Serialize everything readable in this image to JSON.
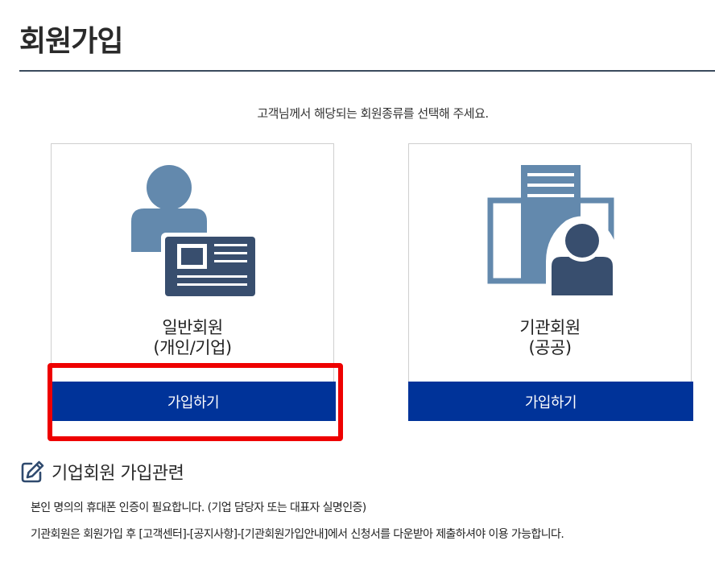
{
  "page": {
    "title": "회원가입",
    "intro": "고객님께서 해당되는 회원종류를 선택해 주세요."
  },
  "cards": [
    {
      "icon": "id-card-person-icon",
      "label_line1": "일반회원",
      "label_line2": "(개인/기업)",
      "button_label": "가입하기"
    },
    {
      "icon": "building-person-icon",
      "label_line1": "기관회원",
      "label_line2": "(공공)",
      "button_label": "가입하기"
    }
  ],
  "section": {
    "icon": "edit-icon",
    "title": "기업회원 가입관련",
    "notices": [
      "본인 명의의 휴대폰 인증이 필요합니다. (기업 담당자 또는 대표자 실명인증)",
      "기관회원은 회원가입 후 [고객센터]-[공지사항]-[기관회원가입안내]에서 신청서를 다운받아 제출하셔야 이용 가능합니다."
    ]
  },
  "colors": {
    "button_bg": "#003399",
    "highlight": "#ee0000",
    "icon_light": "#6389ad",
    "icon_dark": "#384e6e"
  }
}
